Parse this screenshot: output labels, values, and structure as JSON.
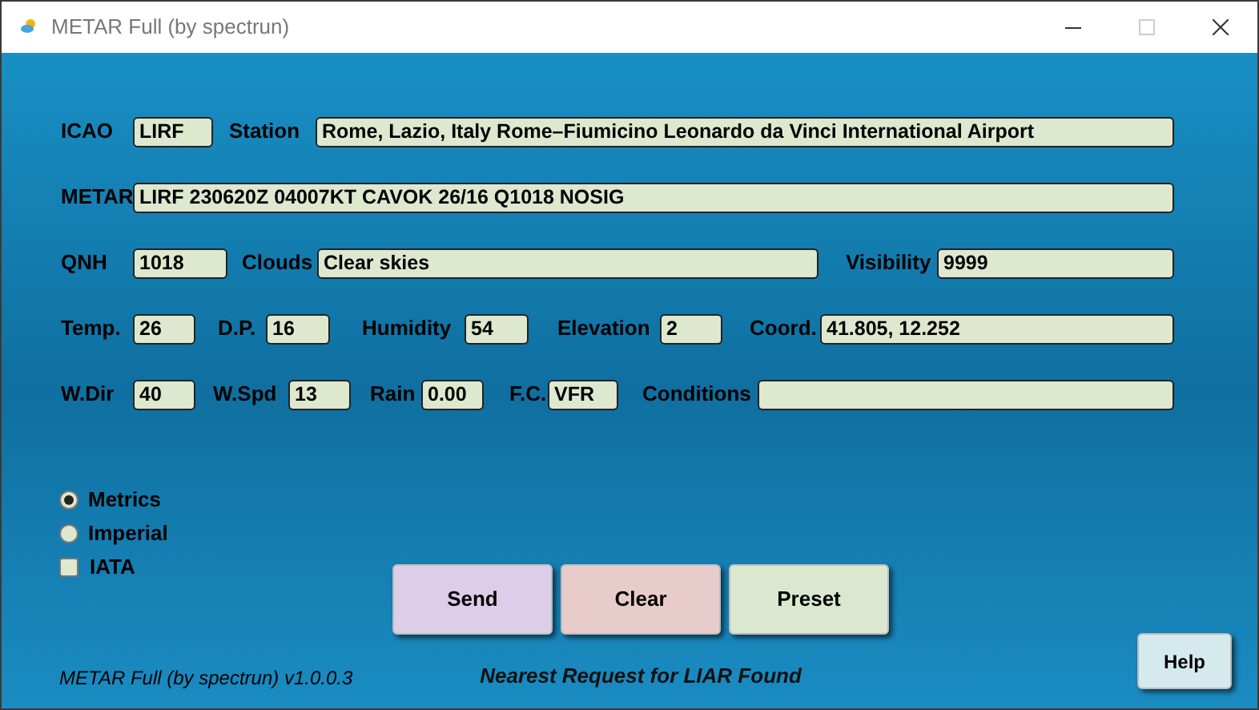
{
  "window": {
    "title": "METAR Full (by spectrun)"
  },
  "rows": [
    [
      {
        "label": "ICAO",
        "value": "LIRF"
      },
      {
        "label": "Station",
        "value": "Rome, Lazio, Italy Rome–Fiumicino Leonardo da Vinci International Airport"
      }
    ],
    [
      {
        "label": "METAR",
        "value": "LIRF 230620Z 04007KT CAVOK 26/16 Q1018 NOSIG"
      }
    ],
    [
      {
        "label": "QNH",
        "value": "1018"
      },
      {
        "label": "Clouds",
        "value": "Clear skies"
      },
      {
        "label": "Visibility",
        "value": "9999"
      }
    ],
    [
      {
        "label": "Temp.",
        "value": "26"
      },
      {
        "label": "D.P.",
        "value": "16"
      },
      {
        "label": "Humidity",
        "value": "54"
      },
      {
        "label": "Elevation",
        "value": "2"
      },
      {
        "label": "Coord.",
        "value": "41.805, 12.252"
      }
    ],
    [
      {
        "label": "W.Dir",
        "value": "40"
      },
      {
        "label": "W.Spd",
        "value": "13"
      },
      {
        "label": "Rain",
        "value": "0.00"
      },
      {
        "label": "F.C.",
        "value": "VFR"
      },
      {
        "label": "Conditions"
      }
    ]
  ],
  "units": [
    {
      "label": "Metrics",
      "selected": true
    },
    {
      "label": "Imperial",
      "selected": false
    }
  ],
  "iata": {
    "label": "IATA",
    "checked": false
  },
  "buttons": [
    {
      "label": "Send",
      "kind": "send"
    },
    {
      "label": "Clear",
      "kind": "clear"
    },
    {
      "label": "Preset",
      "kind": "preset"
    }
  ],
  "version": "METAR Full (by spectrun) v1.0.0.3",
  "status": "Nearest Request for LIAR Found",
  "help": "Help"
}
